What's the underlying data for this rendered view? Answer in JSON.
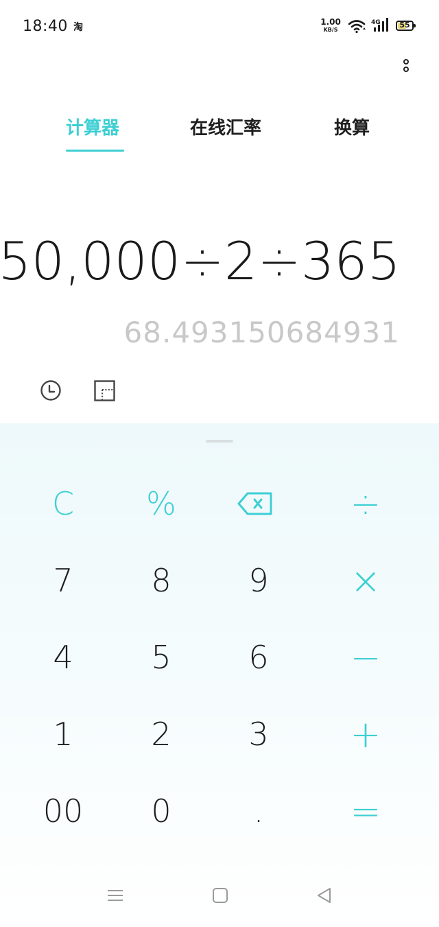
{
  "status_bar": {
    "time": "18:40",
    "app_icon_glyph": "淘",
    "net_speed_value": "1.00",
    "net_speed_unit": "KB/S",
    "network_type": "4G",
    "battery_level": "55"
  },
  "tabs": [
    {
      "label": "计算器",
      "active": true
    },
    {
      "label": "在线汇率",
      "active": false
    },
    {
      "label": "换算",
      "active": false
    }
  ],
  "display": {
    "expression": "50,000÷2÷365",
    "result": "68.493150684931"
  },
  "tools": {
    "history_icon": "clock-icon",
    "unit_icon": "ruler-square-icon"
  },
  "keypad": {
    "rows": [
      [
        "C",
        "%",
        "backspace",
        "÷"
      ],
      [
        "7",
        "8",
        "9",
        "×"
      ],
      [
        "4",
        "5",
        "6",
        "−"
      ],
      [
        "1",
        "2",
        "3",
        "+"
      ],
      [
        "00",
        "0",
        ".",
        "="
      ]
    ]
  },
  "colors": {
    "accent": "#3dcfd3",
    "text": "#1a1a1a",
    "result_text": "#c8c8c8",
    "keypad_bg": "#eef9fb"
  },
  "nav_bar": {
    "icons": [
      "menu-icon",
      "home-icon",
      "back-icon"
    ]
  }
}
